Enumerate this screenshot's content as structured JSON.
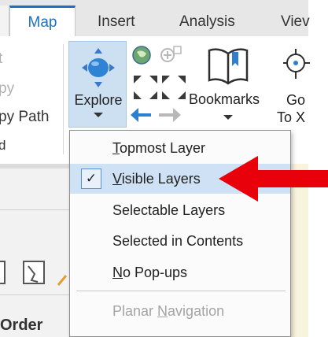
{
  "tabs": {
    "active": "Map",
    "items": [
      "Insert",
      "Analysis",
      "Viev"
    ]
  },
  "ribbon": {
    "left_items": [
      "t",
      "py",
      "py Path",
      "d"
    ],
    "explore_label": "Explore",
    "bookmarks_label": "Bookmarks",
    "goto_line1": "Go",
    "goto_line2": "To X"
  },
  "menu": {
    "items": [
      {
        "label": "Topmost Layer",
        "mnemonic_index": 0,
        "checked": false,
        "enabled": true
      },
      {
        "label": "Visible Layers",
        "mnemonic_index": 0,
        "checked": true,
        "enabled": true
      },
      {
        "label": "Selectable Layers",
        "mnemonic_index": -1,
        "checked": false,
        "enabled": true
      },
      {
        "label": "Selected in Contents",
        "mnemonic_index": -1,
        "checked": false,
        "enabled": true
      },
      {
        "label": "No Pop-ups",
        "mnemonic_index": 0,
        "checked": false,
        "enabled": true
      },
      {
        "label": "Planar Navigation",
        "mnemonic_index": 7,
        "checked": false,
        "enabled": false
      }
    ],
    "check_glyph": "✓"
  },
  "panel": {
    "order_label": "Order"
  },
  "colors": {
    "accent": "#1f6fc1",
    "checked_bg": "#cfe1f4",
    "annotation_arrow": "#e8000b"
  }
}
